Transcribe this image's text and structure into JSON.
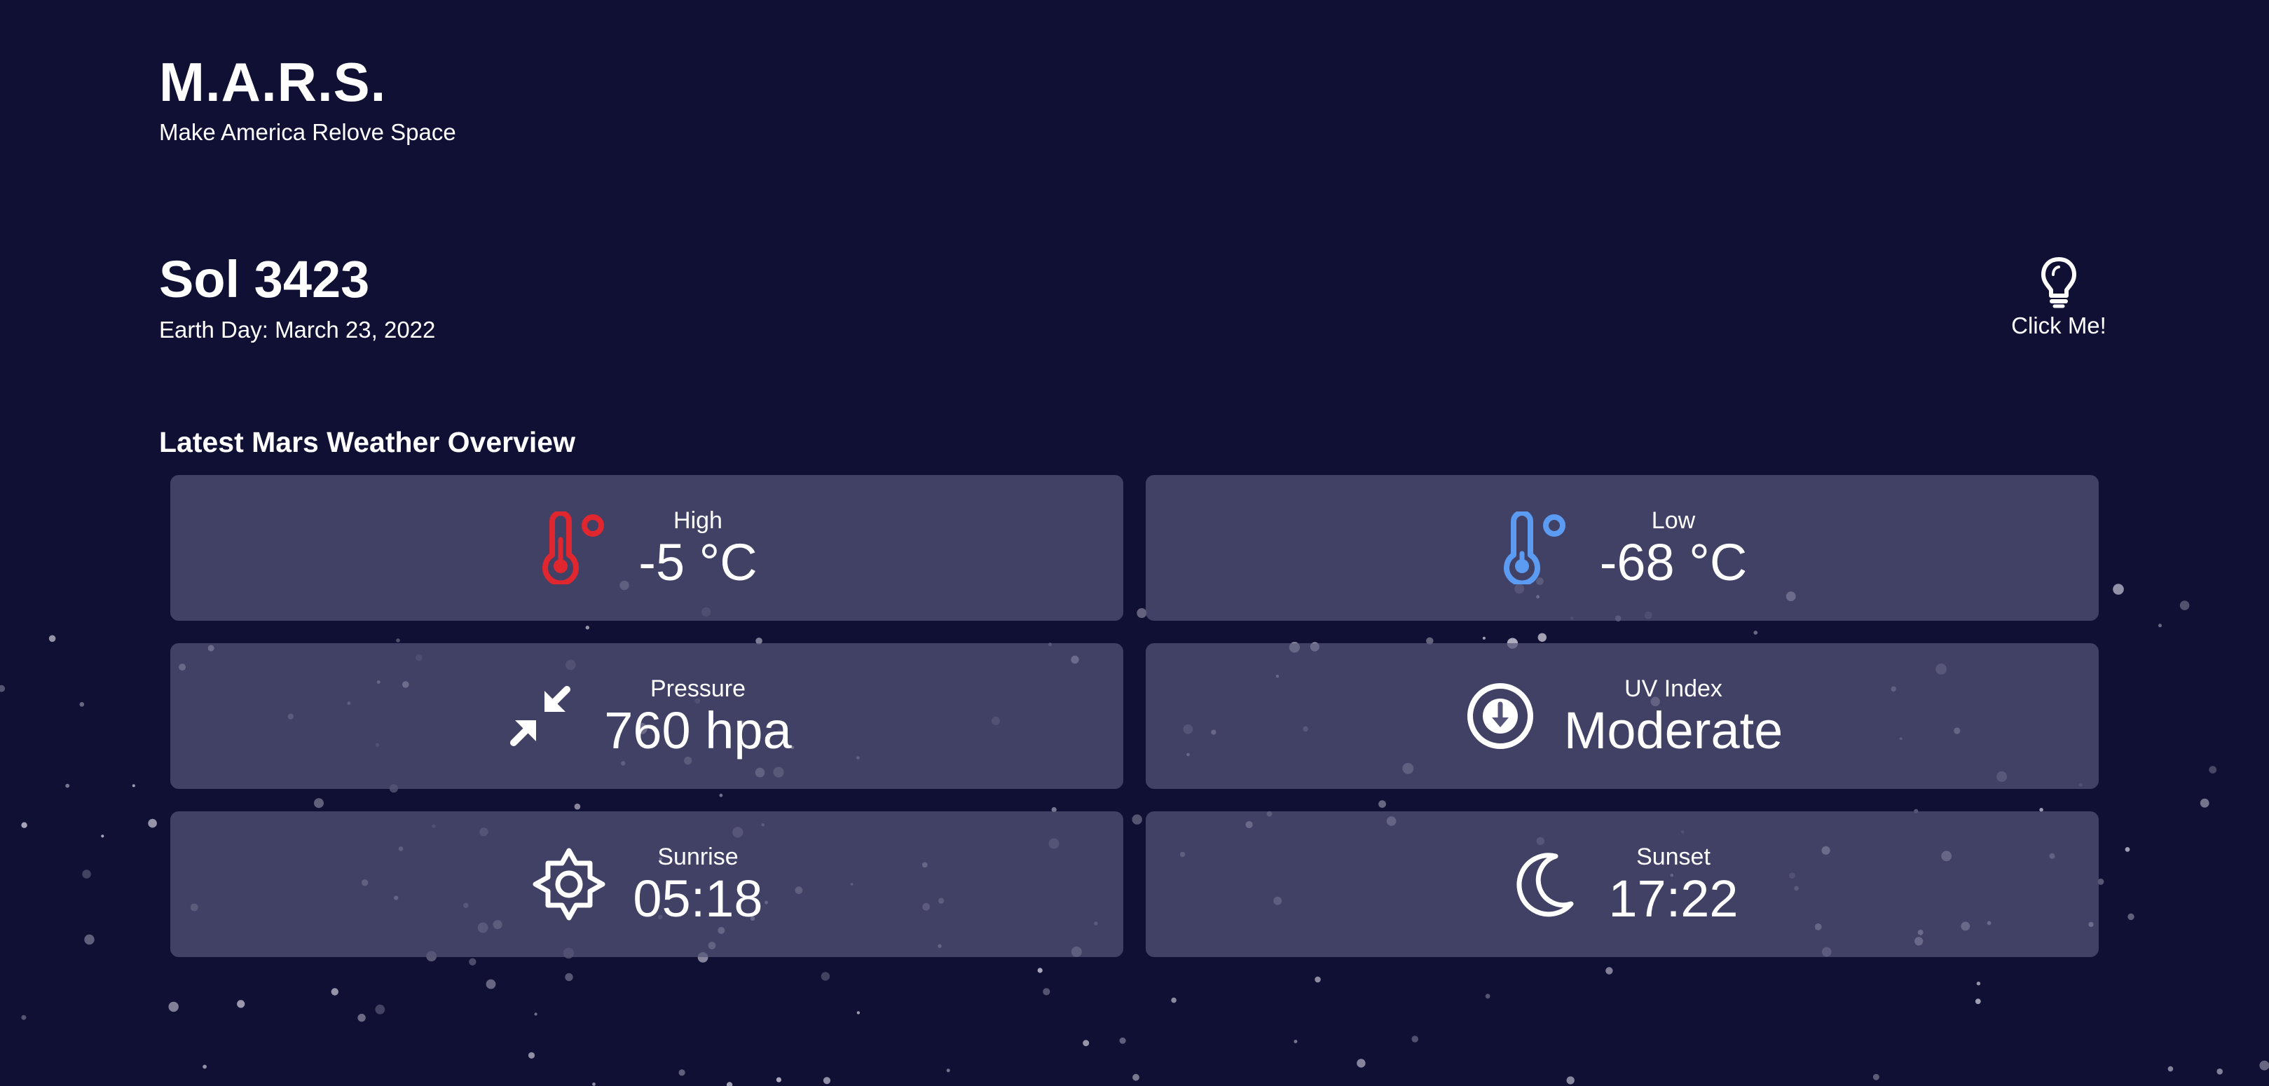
{
  "brand": {
    "title": "M.A.R.S.",
    "subtitle": "Make America Relove Space"
  },
  "sol": {
    "title": "Sol 3423",
    "earth_day": "Earth Day: March 23, 2022"
  },
  "hint": {
    "icon": "lightbulb-icon",
    "label": "Click Me!"
  },
  "overview": {
    "title": "Latest Mars Weather Overview",
    "cards": {
      "high": {
        "label": "High",
        "value": "-5 °C",
        "icon": "thermometer-hot-icon",
        "color": "#e0262f"
      },
      "low": {
        "label": "Low",
        "value": "-68 °C",
        "icon": "thermometer-cold-icon",
        "color": "#5b9bf2"
      },
      "pressure": {
        "label": "Pressure",
        "value": "760 hpa",
        "icon": "compress-arrows-icon"
      },
      "uv": {
        "label": "UV Index",
        "value": "Moderate",
        "icon": "arrow-down-circle-icon"
      },
      "sunrise": {
        "label": "Sunrise",
        "value": "05:18",
        "icon": "sun-icon"
      },
      "sunset": {
        "label": "Sunset",
        "value": "17:22",
        "icon": "moon-icon"
      }
    }
  },
  "colors": {
    "background": "#101035",
    "card": "#55547a",
    "text": "#ffffff"
  }
}
